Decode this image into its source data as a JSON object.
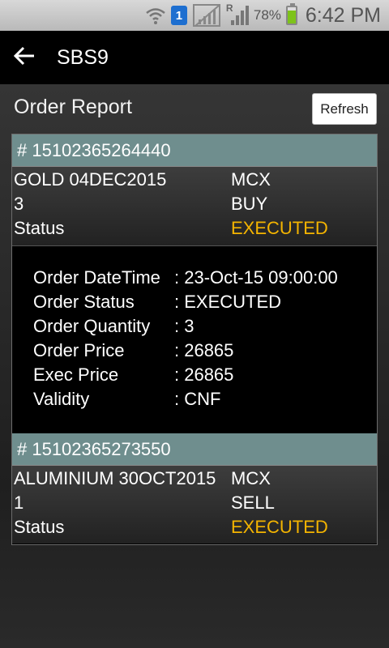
{
  "status_bar": {
    "notification_count": "1",
    "network_label": "R",
    "battery_percent": "78%",
    "battery_level": 0.78,
    "time": "6:42 PM",
    "icons": [
      "wifi-icon",
      "notification-icon",
      "no-sim-icon",
      "signal-icon",
      "battery-icon"
    ]
  },
  "app_bar": {
    "title": "SBS9",
    "back_icon": "arrow-left-icon"
  },
  "page": {
    "title": "Order Report",
    "refresh_label": "Refresh"
  },
  "colors": {
    "order_header": "#6f8e8e",
    "executed": "#f4b400",
    "app_bar": "#000000"
  },
  "orders": [
    {
      "id": "# 15102365264440",
      "symbol": "GOLD 04DEC2015",
      "exchange": "MCX",
      "quantity": "3",
      "side": "BUY",
      "status_label": "Status",
      "status": "EXECUTED",
      "expanded": true,
      "details": [
        {
          "label": "Order DateTime",
          "value": ": 23-Oct-15 09:00:00"
        },
        {
          "label": "Order Status",
          "value": ": EXECUTED"
        },
        {
          "label": "Order Quantity",
          "value": ": 3"
        },
        {
          "label": "Order Price",
          "value": ": 26865"
        },
        {
          "label": "Exec Price",
          "value": ": 26865"
        },
        {
          "label": "Validity",
          "value": ": CNF"
        }
      ]
    },
    {
      "id": "# 15102365273550",
      "symbol": "ALUMINIUM 30OCT2015",
      "exchange": "MCX",
      "quantity": "1",
      "side": "SELL",
      "status_label": "Status",
      "status": "EXECUTED",
      "expanded": false
    }
  ]
}
